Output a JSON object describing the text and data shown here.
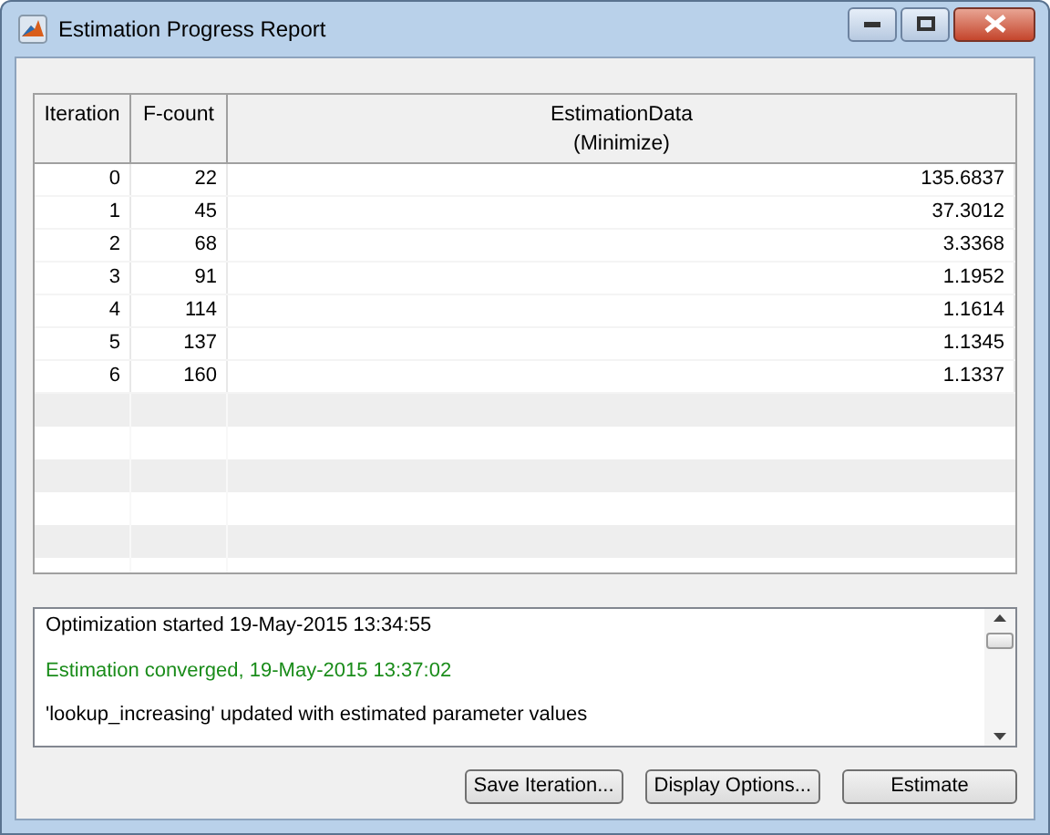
{
  "window": {
    "title": "Estimation Progress Report"
  },
  "table": {
    "columns": [
      {
        "label": "Iteration"
      },
      {
        "label": "F-count"
      },
      {
        "label": "EstimationData",
        "sublabel": "(Minimize)"
      }
    ],
    "rows": [
      {
        "iteration": "0",
        "fcount": "22",
        "value": "135.6837"
      },
      {
        "iteration": "1",
        "fcount": "45",
        "value": "37.3012"
      },
      {
        "iteration": "2",
        "fcount": "68",
        "value": "3.3368"
      },
      {
        "iteration": "3",
        "fcount": "91",
        "value": "1.1952"
      },
      {
        "iteration": "4",
        "fcount": "114",
        "value": "1.1614"
      },
      {
        "iteration": "5",
        "fcount": "137",
        "value": "1.1345"
      },
      {
        "iteration": "6",
        "fcount": "160",
        "value": "1.1337"
      }
    ]
  },
  "log": [
    {
      "text": "Optimization started 19-May-2015 13:34:55",
      "kind": "info"
    },
    {
      "text": "Estimation converged, 19-May-2015 13:37:02",
      "kind": "success"
    },
    {
      "text": "'lookup_increasing' updated with estimated parameter values",
      "kind": "info"
    }
  ],
  "buttons": [
    "Save Iteration...",
    "Display Options...",
    "Estimate"
  ]
}
